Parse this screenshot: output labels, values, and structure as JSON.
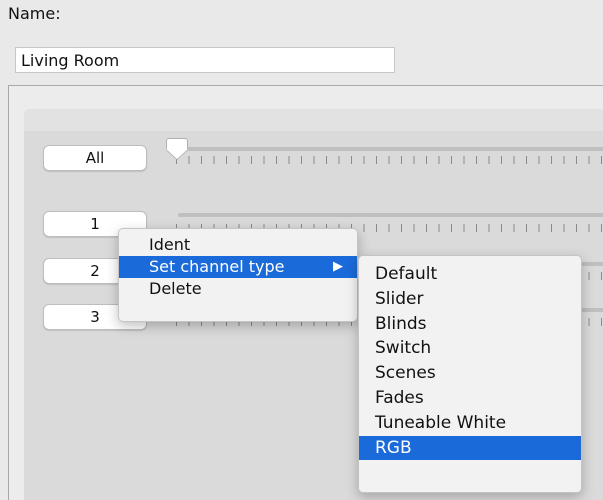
{
  "form": {
    "name_label": "Name:",
    "name_value": "Living Room"
  },
  "channels": [
    {
      "label": "All"
    },
    {
      "label": "1"
    },
    {
      "label": "2"
    },
    {
      "label": "3"
    }
  ],
  "context_menu": {
    "items": [
      "Ident",
      "Set channel type",
      "Delete"
    ],
    "submenu_arrow": "▶"
  },
  "submenu": {
    "items": [
      "Default",
      "Slider",
      "Blinds",
      "Switch",
      "Scenes",
      "Fades",
      "Tuneable White",
      "RGB"
    ],
    "selected": "RGB"
  },
  "colors": {
    "selection": "#1a6ad9"
  }
}
